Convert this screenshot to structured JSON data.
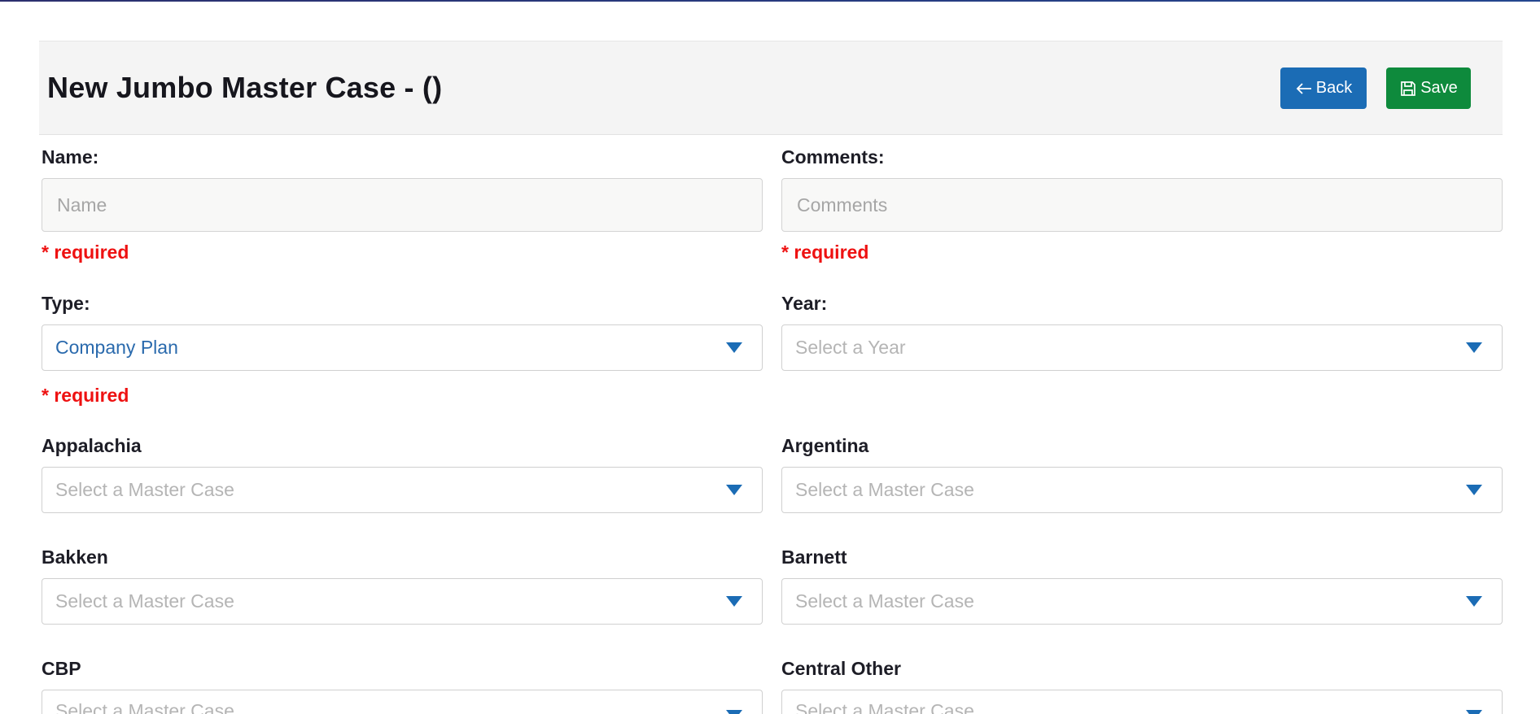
{
  "header": {
    "title": "New Jumbo Master Case - ()",
    "back_label": "Back",
    "save_label": "Save"
  },
  "form": {
    "name": {
      "label": "Name:",
      "placeholder": "Name",
      "value": "",
      "required_text": "* required"
    },
    "comments": {
      "label": "Comments:",
      "placeholder": "Comments",
      "value": "",
      "required_text": "* required"
    },
    "type": {
      "label": "Type:",
      "value": "Company Plan",
      "required_text": "* required"
    },
    "year": {
      "label": "Year:",
      "value": "Select a Year"
    },
    "regions": [
      {
        "label": "Appalachia",
        "value": "Select a Master Case"
      },
      {
        "label": "Argentina",
        "value": "Select a Master Case"
      },
      {
        "label": "Bakken",
        "value": "Select a Master Case"
      },
      {
        "label": "Barnett",
        "value": "Select a Master Case"
      },
      {
        "label": "CBP",
        "value": "Select a Master Case"
      },
      {
        "label": "Central Other",
        "value": "Select a Master Case"
      }
    ]
  },
  "colors": {
    "back_button": "#1b6cb5",
    "save_button": "#0e8a3c",
    "required": "#ee1111",
    "dropdown_caret": "#1b6cb5"
  },
  "icons": {
    "back": "arrow-left-icon",
    "save": "floppy-disk-icon",
    "dropdown": "caret-down-icon"
  }
}
